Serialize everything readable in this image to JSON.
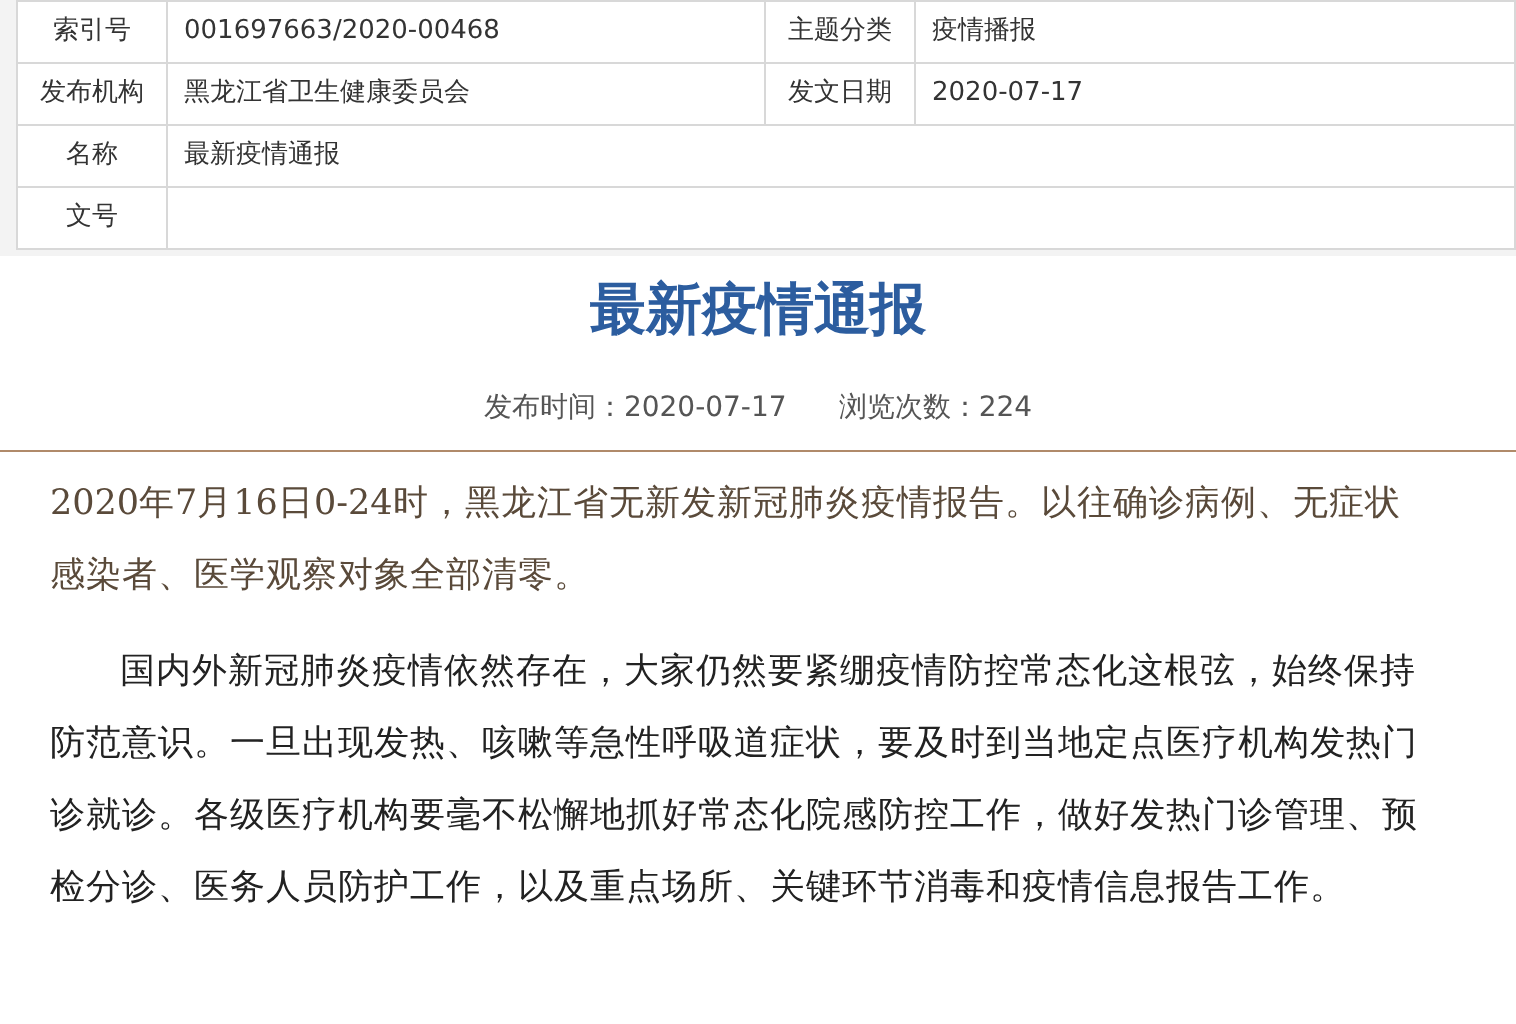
{
  "info_table": {
    "rows": [
      {
        "cells": [
          {
            "label": "索引号",
            "value": "001697663/2020-00468"
          },
          {
            "label": "主题分类",
            "value": "疫情播报"
          }
        ]
      },
      {
        "cells": [
          {
            "label": "发布机构",
            "value": "黑龙江省卫生健康委员会"
          },
          {
            "label": "发文日期",
            "value": "2020-07-17"
          }
        ]
      },
      {
        "cells": [
          {
            "label": "名称",
            "value": "最新疫情通报"
          }
        ]
      },
      {
        "cells": [
          {
            "label": "文号"
          }
        ]
      }
    ]
  },
  "article": {
    "title": "最新疫情通报",
    "publish_time": "发布时间：2020-07-17",
    "views": "浏览次数：224",
    "paragraphs": [
      "2020年7月16日0-24时，黑龙江省无新发新冠肺炎疫情报告。以往确诊病例、无症状感染者、医学观察对象全部清零。",
      "国内外新冠肺炎疫情依然存在，大家仍然要紧绷疫情防控常态化这根弦，始终保持防范意识。一旦出现发热、咳嗽等急性呼吸道症状，要及时到当地定点医疗机构发热门诊就诊。各级医疗机构要毫不松懈地抓好常态化院感防控工作，做好发热门诊管理、预检分诊、医务人员防护工作，以及重点场所、关键环节消毒和疫情信息报告工作。"
    ]
  }
}
